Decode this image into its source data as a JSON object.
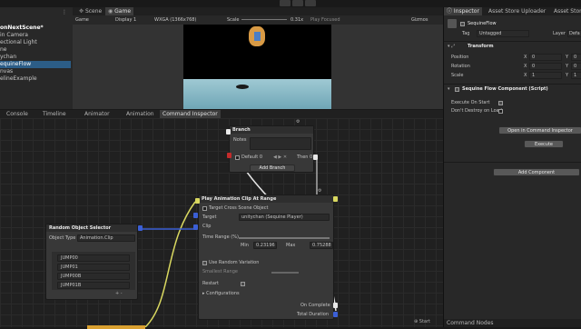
{
  "hierarchy": {
    "items": [
      "onNextScene*",
      "in Camera",
      "ectional Light",
      "ne",
      "ychan",
      "equineFlow",
      "nvas",
      "elineExample"
    ],
    "selected_index": 5
  },
  "scene_tabs": {
    "scene": "Scene",
    "game": "Game"
  },
  "game_bar": {
    "mode": "Game",
    "display": "Display 1",
    "resolution": "WXGA (1366x768)",
    "scale_label": "Scale",
    "scale_value": "0.31x",
    "play_focused": "Play Focused",
    "gizmos": "Gizmos"
  },
  "bottom_tabs": [
    "Console",
    "Timeline",
    "Animator",
    "Animation",
    "Command Inspector"
  ],
  "nodes": {
    "branch": {
      "title": "Branch",
      "notes": "Notes",
      "default_label": "Default 0",
      "then_label": "Then 0",
      "add_branch": "Add Branch"
    },
    "play_anim": {
      "title": "Play Animation Clip At Range",
      "target_cross": "Target Cross Scene Object",
      "target_label": "Target",
      "target_value": "unitychan (Sequine Player)",
      "clip_label": "Clip",
      "time_range": "Time Range (%)",
      "min_label": "Min",
      "min_value": "0.23196",
      "max_label": "Max",
      "max_value": "0.75288",
      "use_random": "Use Random Variation",
      "smallest_range": "Smallest Range",
      "restart": "Restart",
      "configurations": "Configurations",
      "on_complete": "On Complete",
      "total_duration": "Total Duration"
    },
    "random_selector": {
      "title": "Random Object Selector",
      "object_type_label": "Object Type",
      "object_type_value": "Animation.Clip",
      "items": [
        "JUMP00",
        "JUMP01",
        "JUMP00B",
        "JUMP01B"
      ]
    },
    "start_label": "Start"
  },
  "inspector": {
    "tabs": [
      "Inspector",
      "Asset Store Uploader",
      "Asset Store Up"
    ],
    "object_name": "SequineFlow",
    "tag_label": "Tag",
    "tag_value": "Untagged",
    "layer_label": "Layer",
    "layer_value": "Defa",
    "transform_title": "Transform",
    "position_label": "Position",
    "rotation_label": "Rotation",
    "scale_label": "Scale",
    "pos": {
      "x": "0",
      "y": "0"
    },
    "rot": {
      "x": "0",
      "y": "0"
    },
    "scl": {
      "x": "1",
      "y": "1"
    },
    "axis_x": "X",
    "axis_y": "Y",
    "component_title": "Sequine Flow Component (Script)",
    "execute_on_start": "Execute On Start",
    "dont_destroy": "Don't Destroy on Load",
    "open_cmd_inspector": "Open in Command Inspector",
    "execute": "Execute",
    "add_component": "Add Component",
    "command_nodes": "Command Nodes"
  },
  "colors": {
    "accent_blue": "#2c5d87",
    "port_blue": "#3b5fd6",
    "port_red": "#c42b2b",
    "wire_yellow": "#d9d860",
    "wire_white": "#e8e8e8",
    "sky": "#000000",
    "floor": "#7fb4c4"
  }
}
